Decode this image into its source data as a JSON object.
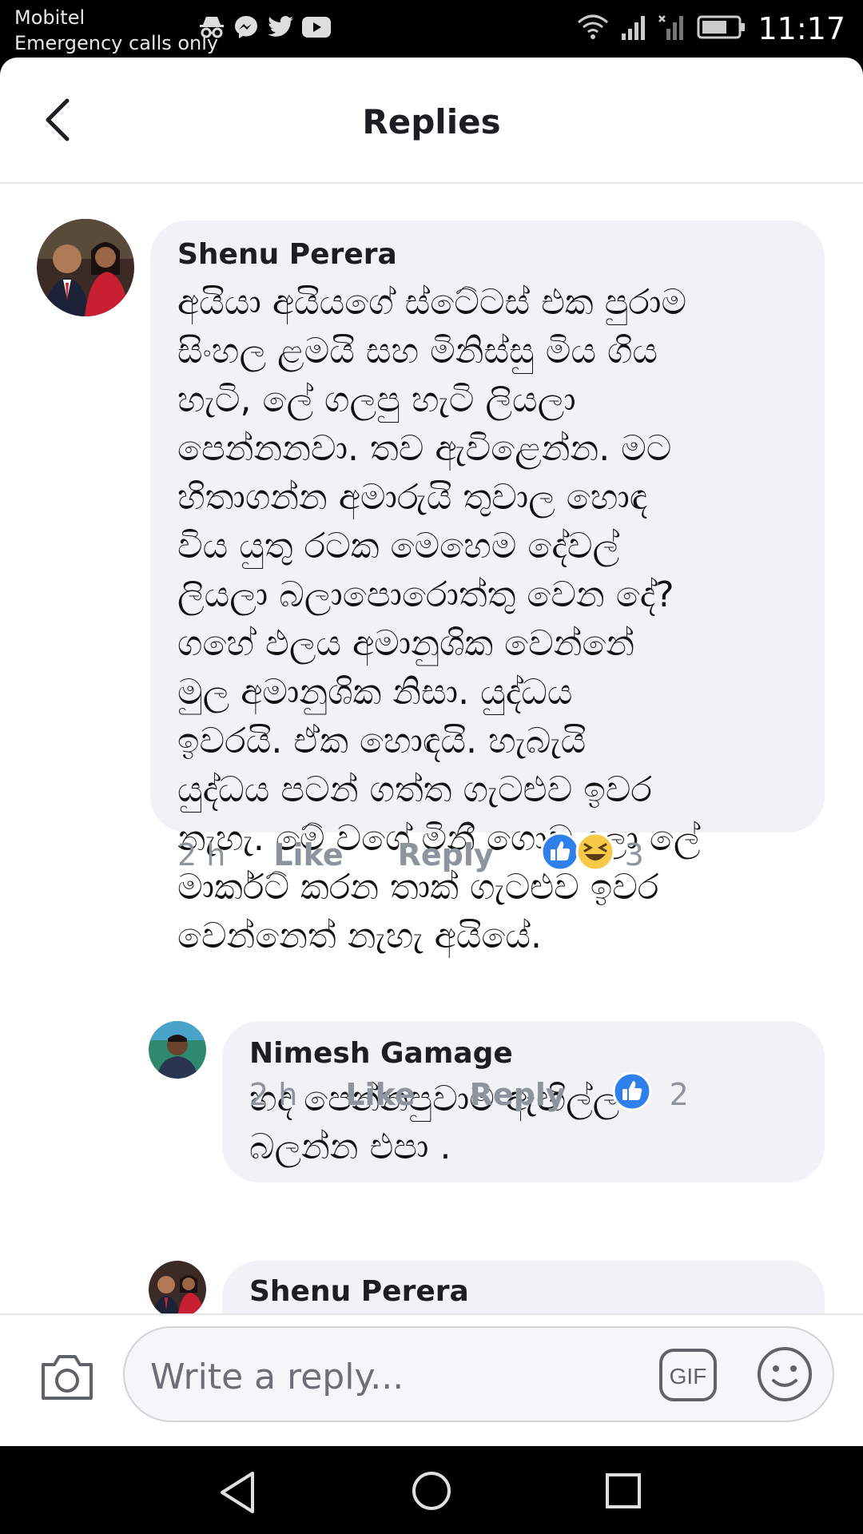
{
  "status_bar": {
    "carrier": "Mobitel",
    "emergency": "Emergency calls only",
    "time": "11:17"
  },
  "header": {
    "title": "Replies"
  },
  "comments": [
    {
      "author": "Shenu Perera",
      "text": "අයියා අයියගේ ස්ටේටස් එක පුරාම\nසිංහල ළමයි සහ මිනිස්සු මිය ගිය\nහැටි, ලේ ගලපු හැටි ලියලා\nපෙන්නනවා. තව ඇවිළෙන්න. මට\nහිතාගන්න අමාරුයි තුවාල හොඳ\nවිය යුතු රටක මෙහෙම දේවල්\nලියලා බලාපොරොත්තු වෙන දේ?\nගහේ ඵලය අමානුශික වෙන්නේ\nමුල අමානුශික නිසා. යුද්ධය\nඉවරයි. ඒක හොඳයි. හැබැයි\nයුද්ධය පටන් ගත්ත ගැටළුව ඉවර\nනැහැ. මේ වගේ මිනී ගොඩ දලා ලේ\nමාර්කට් කරන තාක් ගැටළුව ඉවර\nවෙන්නෙත් නැහැ අයියේ.",
      "time": "2 h",
      "like": "Like",
      "reply": "Reply",
      "reaction_count": "3"
    },
    {
      "author": "Nimesh Gamage",
      "text": "හද පෙන්නපුවාම ඇඟිල්ල\nබලන්න එපා .",
      "time": "2 h",
      "like": "Like",
      "reply": "Reply",
      "reaction_count": "2"
    },
    {
      "author": "Shenu Perera"
    }
  ],
  "composer": {
    "placeholder": "Write a reply...",
    "gif_label": "GIF"
  },
  "colors": {
    "like_blue": "#2f80ed",
    "haha_yellow": "#f7c948",
    "bubble_bg": "#f0f2f5"
  }
}
